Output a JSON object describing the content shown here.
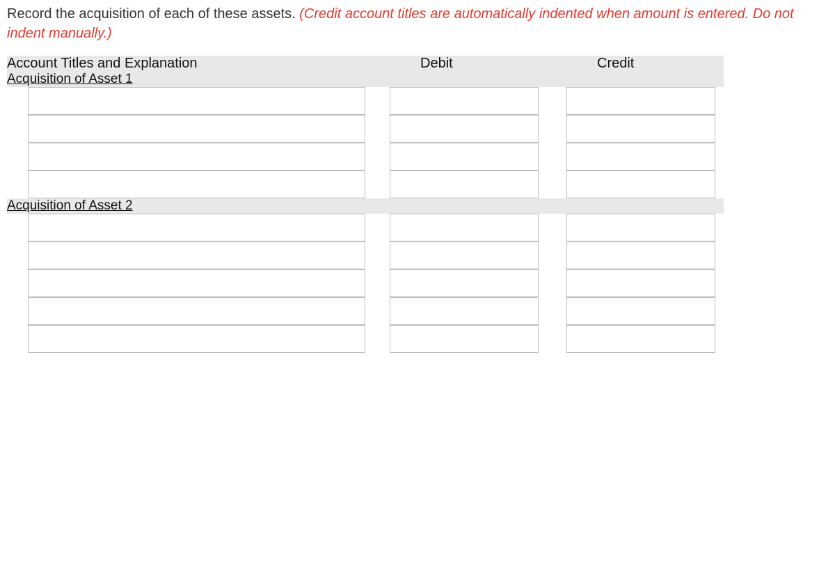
{
  "instructions": {
    "plain": "Record the acquisition of each of these assets. ",
    "red": "(Credit account titles are automatically indented when amount is entered. Do not indent manually.)"
  },
  "headers": {
    "account": "Account Titles and Explanation",
    "debit": "Debit",
    "credit": "Credit"
  },
  "sections": [
    {
      "title": "Acquisition of Asset 1",
      "rows": [
        {
          "account": "",
          "debit": "",
          "credit": ""
        },
        {
          "account": "",
          "debit": "",
          "credit": ""
        },
        {
          "account": "",
          "debit": "",
          "credit": ""
        },
        {
          "account": "",
          "debit": "",
          "credit": ""
        }
      ]
    },
    {
      "title": "Acquisition of Asset 2",
      "rows": [
        {
          "account": "",
          "debit": "",
          "credit": ""
        },
        {
          "account": "",
          "debit": "",
          "credit": ""
        },
        {
          "account": "",
          "debit": "",
          "credit": ""
        },
        {
          "account": "",
          "debit": "",
          "credit": ""
        },
        {
          "account": "",
          "debit": "",
          "credit": ""
        }
      ]
    }
  ]
}
